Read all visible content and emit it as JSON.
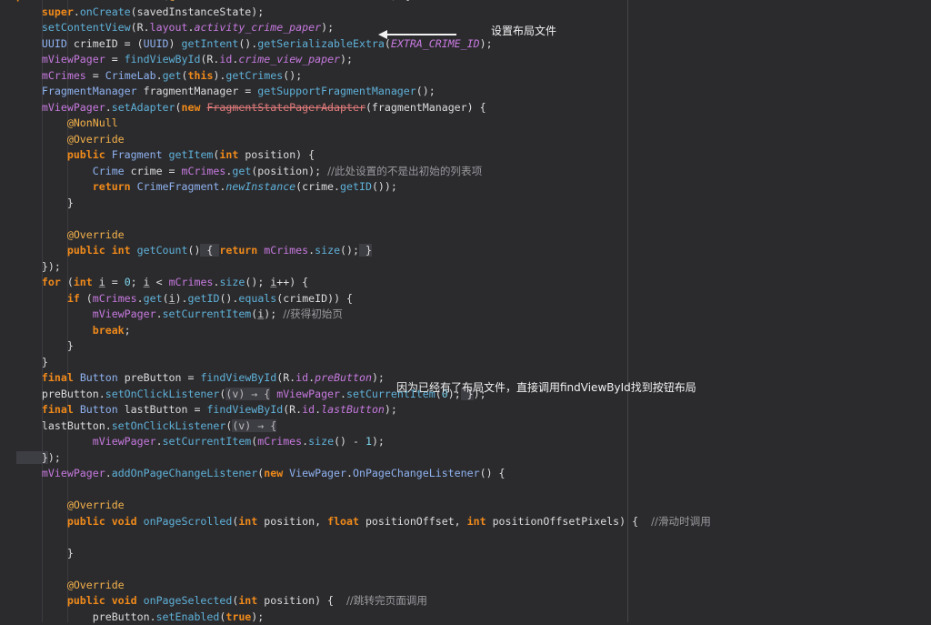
{
  "lines": [
    [
      [
        "kw",
        "protected void "
      ],
      [
        "fn",
        "onCreate"
      ],
      [
        "p",
        "("
      ],
      [
        "ann",
        "@Nullable "
      ],
      [
        "type",
        "Bundle "
      ],
      [
        "p",
        "savedInstanceState) {"
      ]
    ],
    [
      [
        "p",
        "    "
      ],
      [
        "kw",
        "super"
      ],
      [
        "p",
        "."
      ],
      [
        "fn",
        "onCreate"
      ],
      [
        "p",
        "(savedInstanceState);"
      ]
    ],
    [
      [
        "p",
        "    "
      ],
      [
        "fn",
        "setContentView"
      ],
      [
        "p",
        "(R."
      ],
      [
        "field",
        "layout"
      ],
      [
        "p",
        "."
      ],
      [
        "fieldi",
        "activity_crime_paper"
      ],
      [
        "p",
        ");"
      ]
    ],
    [
      [
        "p",
        "    "
      ],
      [
        "type",
        "UUID "
      ],
      [
        "p",
        "crimeID = ("
      ],
      [
        "type",
        "UUID"
      ],
      [
        "p",
        ") "
      ],
      [
        "fn",
        "getIntent"
      ],
      [
        "p",
        "()."
      ],
      [
        "fn",
        "getSerializableExtra"
      ],
      [
        "p",
        "("
      ],
      [
        "fieldi",
        "EXTRA_CRIME_ID"
      ],
      [
        "p",
        ");"
      ]
    ],
    [
      [
        "p",
        "    "
      ],
      [
        "field",
        "mViewPager"
      ],
      [
        "p",
        " = "
      ],
      [
        "fn",
        "findViewById"
      ],
      [
        "p",
        "(R."
      ],
      [
        "field",
        "id"
      ],
      [
        "p",
        "."
      ],
      [
        "fieldi",
        "crime_view_paper"
      ],
      [
        "p",
        ");"
      ]
    ],
    [
      [
        "p",
        "    "
      ],
      [
        "field",
        "mCrimes"
      ],
      [
        "p",
        " = "
      ],
      [
        "type",
        "CrimeLab"
      ],
      [
        "p",
        "."
      ],
      [
        "fn",
        "get"
      ],
      [
        "p",
        "("
      ],
      [
        "kw",
        "this"
      ],
      [
        "p",
        ")."
      ],
      [
        "fn",
        "getCrimes"
      ],
      [
        "p",
        "();"
      ]
    ],
    [
      [
        "p",
        "    "
      ],
      [
        "type",
        "FragmentManager "
      ],
      [
        "p",
        "fragmentManager = "
      ],
      [
        "fn",
        "getSupportFragmentManager"
      ],
      [
        "p",
        "();"
      ]
    ],
    [
      [
        "p",
        "    "
      ],
      [
        "field",
        "mViewPager"
      ],
      [
        "p",
        "."
      ],
      [
        "fn",
        "setAdapter"
      ],
      [
        "p",
        "("
      ],
      [
        "kw",
        "new "
      ],
      [
        "strike",
        "FragmentStatePagerAdapter"
      ],
      [
        "p",
        "(fragmentManager) {"
      ]
    ],
    [
      [
        "p",
        "        "
      ],
      [
        "ann",
        "@NonNull"
      ]
    ],
    [
      [
        "p",
        "        "
      ],
      [
        "ann",
        "@Override"
      ]
    ],
    [
      [
        "p",
        "        "
      ],
      [
        "kw",
        "public "
      ],
      [
        "type",
        "Fragment "
      ],
      [
        "fn",
        "getItem"
      ],
      [
        "p",
        "("
      ],
      [
        "kw",
        "int "
      ],
      [
        "p",
        "position) {"
      ]
    ],
    [
      [
        "p",
        "            "
      ],
      [
        "type",
        "Crime "
      ],
      [
        "p",
        "crime = "
      ],
      [
        "field",
        "mCrimes"
      ],
      [
        "p",
        "."
      ],
      [
        "fn",
        "get"
      ],
      [
        "p",
        "(position); "
      ],
      [
        "cmt",
        "//此处设置的不是出初始的列表项"
      ]
    ],
    [
      [
        "p",
        "            "
      ],
      [
        "kw",
        "return "
      ],
      [
        "type",
        "CrimeFragment"
      ],
      [
        "p",
        "."
      ],
      [
        "fnitalic",
        "newInstance"
      ],
      [
        "p",
        "(crime."
      ],
      [
        "fn",
        "getID"
      ],
      [
        "p",
        "());"
      ]
    ],
    [
      [
        "p",
        "        }"
      ]
    ],
    [
      [
        "p",
        ""
      ]
    ],
    [
      [
        "p",
        "        "
      ],
      [
        "ann",
        "@Override"
      ]
    ],
    [
      [
        "p",
        "        "
      ],
      [
        "kw",
        "public int "
      ],
      [
        "fn",
        "getCount"
      ],
      [
        "p",
        "()"
      ],
      [
        "brace",
        " { "
      ],
      [
        "kw",
        "return "
      ],
      [
        "field",
        "mCrimes"
      ],
      [
        "p",
        "."
      ],
      [
        "fn",
        "size"
      ],
      [
        "p",
        "();"
      ],
      [
        "brace",
        " }"
      ]
    ],
    [
      [
        "p",
        "    });"
      ]
    ],
    [
      [
        "p",
        "    "
      ],
      [
        "kw",
        "for "
      ],
      [
        "p",
        "("
      ],
      [
        "kw",
        "int "
      ],
      [
        "var",
        "i"
      ],
      [
        "p",
        " = "
      ],
      [
        "num",
        "0"
      ],
      [
        "p",
        "; "
      ],
      [
        "var",
        "i"
      ],
      [
        "p",
        " < "
      ],
      [
        "field",
        "mCrimes"
      ],
      [
        "p",
        "."
      ],
      [
        "fn",
        "size"
      ],
      [
        "p",
        "(); "
      ],
      [
        "var",
        "i"
      ],
      [
        "p",
        "++) {"
      ]
    ],
    [
      [
        "p",
        "        "
      ],
      [
        "kw",
        "if "
      ],
      [
        "p",
        "("
      ],
      [
        "field",
        "mCrimes"
      ],
      [
        "p",
        "."
      ],
      [
        "fn",
        "get"
      ],
      [
        "p",
        "("
      ],
      [
        "var",
        "i"
      ],
      [
        "p",
        ")."
      ],
      [
        "fn",
        "getID"
      ],
      [
        "p",
        "()."
      ],
      [
        "fn",
        "equals"
      ],
      [
        "p",
        "(crimeID)) {"
      ]
    ],
    [
      [
        "p",
        "            "
      ],
      [
        "field",
        "mViewPager"
      ],
      [
        "p",
        "."
      ],
      [
        "fn",
        "setCurrentItem"
      ],
      [
        "p",
        "("
      ],
      [
        "var",
        "i"
      ],
      [
        "p",
        "); "
      ],
      [
        "cmt",
        "//获得初始页"
      ]
    ],
    [
      [
        "p",
        "            "
      ],
      [
        "kw",
        "break"
      ],
      [
        "p",
        ";"
      ]
    ],
    [
      [
        "p",
        "        }"
      ]
    ],
    [
      [
        "p",
        "    }"
      ]
    ],
    [
      [
        "p",
        "    "
      ],
      [
        "kw",
        "final "
      ],
      [
        "type",
        "Button "
      ],
      [
        "p",
        "preButton = "
      ],
      [
        "fn",
        "findViewById"
      ],
      [
        "p",
        "(R."
      ],
      [
        "field",
        "id"
      ],
      [
        "p",
        "."
      ],
      [
        "fieldi",
        "preButton"
      ],
      [
        "p",
        ");"
      ]
    ],
    [
      [
        "p",
        "    preButton."
      ],
      [
        "fn",
        "setOnClickListener"
      ],
      [
        "p",
        "("
      ],
      [
        "lambda",
        "(v) → {"
      ],
      [
        "p",
        " "
      ],
      [
        "field",
        "mViewPager"
      ],
      [
        "p",
        "."
      ],
      [
        "fn",
        "setCurrentItem"
      ],
      [
        "p",
        "("
      ],
      [
        "num",
        "0"
      ],
      [
        "p",
        ");"
      ],
      [
        "brace",
        " }"
      ],
      [
        "p",
        ");"
      ]
    ],
    [
      [
        "p",
        "    "
      ],
      [
        "kw",
        "final "
      ],
      [
        "type",
        "Button "
      ],
      [
        "p",
        "lastButton = "
      ],
      [
        "fn",
        "findViewById"
      ],
      [
        "p",
        "(R."
      ],
      [
        "field",
        "id"
      ],
      [
        "p",
        "."
      ],
      [
        "fieldi",
        "lastButton"
      ],
      [
        "p",
        ");"
      ]
    ],
    [
      [
        "p",
        "    lastButton."
      ],
      [
        "fn",
        "setOnClickListener"
      ],
      [
        "p",
        "("
      ],
      [
        "lambda",
        "(v) → {"
      ]
    ],
    [
      [
        "p",
        "            "
      ],
      [
        "field",
        "mViewPager"
      ],
      [
        "p",
        "."
      ],
      [
        "fn",
        "setCurrentItem"
      ],
      [
        "p",
        "("
      ],
      [
        "field",
        "mCrimes"
      ],
      [
        "p",
        "."
      ],
      [
        "fn",
        "size"
      ],
      [
        "p",
        "() - "
      ],
      [
        "num",
        "1"
      ],
      [
        "p",
        ");"
      ]
    ],
    [
      [
        "brace",
        "    }"
      ],
      [
        "p",
        ");"
      ]
    ],
    [
      [
        "p",
        "    "
      ],
      [
        "field",
        "mViewPager"
      ],
      [
        "p",
        "."
      ],
      [
        "fn",
        "addOnPageChangeListener"
      ],
      [
        "p",
        "("
      ],
      [
        "kw",
        "new "
      ],
      [
        "type",
        "ViewPager"
      ],
      [
        "p",
        "."
      ],
      [
        "type",
        "OnPageChangeListener"
      ],
      [
        "p",
        "() {"
      ]
    ],
    [
      [
        "p",
        ""
      ]
    ],
    [
      [
        "p",
        "        "
      ],
      [
        "ann",
        "@Override"
      ]
    ],
    [
      [
        "p",
        "        "
      ],
      [
        "kw",
        "public void "
      ],
      [
        "fn",
        "onPageScrolled"
      ],
      [
        "p",
        "("
      ],
      [
        "kw",
        "int "
      ],
      [
        "p",
        "position, "
      ],
      [
        "kw",
        "float "
      ],
      [
        "p",
        "positionOffset, "
      ],
      [
        "kw",
        "int "
      ],
      [
        "p",
        "positionOffsetPixels) {  "
      ],
      [
        "cmt",
        "//滑动时调用"
      ]
    ],
    [
      [
        "p",
        ""
      ]
    ],
    [
      [
        "p",
        "        }"
      ]
    ],
    [
      [
        "p",
        ""
      ]
    ],
    [
      [
        "p",
        "        "
      ],
      [
        "ann",
        "@Override"
      ]
    ],
    [
      [
        "p",
        "        "
      ],
      [
        "kw",
        "public void "
      ],
      [
        "fn",
        "onPageSelected"
      ],
      [
        "p",
        "("
      ],
      [
        "kw",
        "int "
      ],
      [
        "p",
        "position) {  "
      ],
      [
        "cmt",
        "//跳转完页面调用"
      ]
    ],
    [
      [
        "p",
        "            preButton."
      ],
      [
        "fn",
        "setEnabled"
      ],
      [
        "p",
        "("
      ],
      [
        "kw",
        "true"
      ],
      [
        "p",
        ");"
      ]
    ]
  ],
  "annotations": {
    "layout_note": "设置布局文件",
    "button_note": "因为已经有了布局文件，直接调用findViewById找到按钮布局"
  },
  "colors": {
    "background": "#2b2b2e",
    "keyword": "#f08a1a",
    "function": "#5fb1d8",
    "type": "#8fb2ef",
    "field": "#c679dd",
    "annotation": "#f5b24a",
    "comment": "#9a9a9e"
  }
}
